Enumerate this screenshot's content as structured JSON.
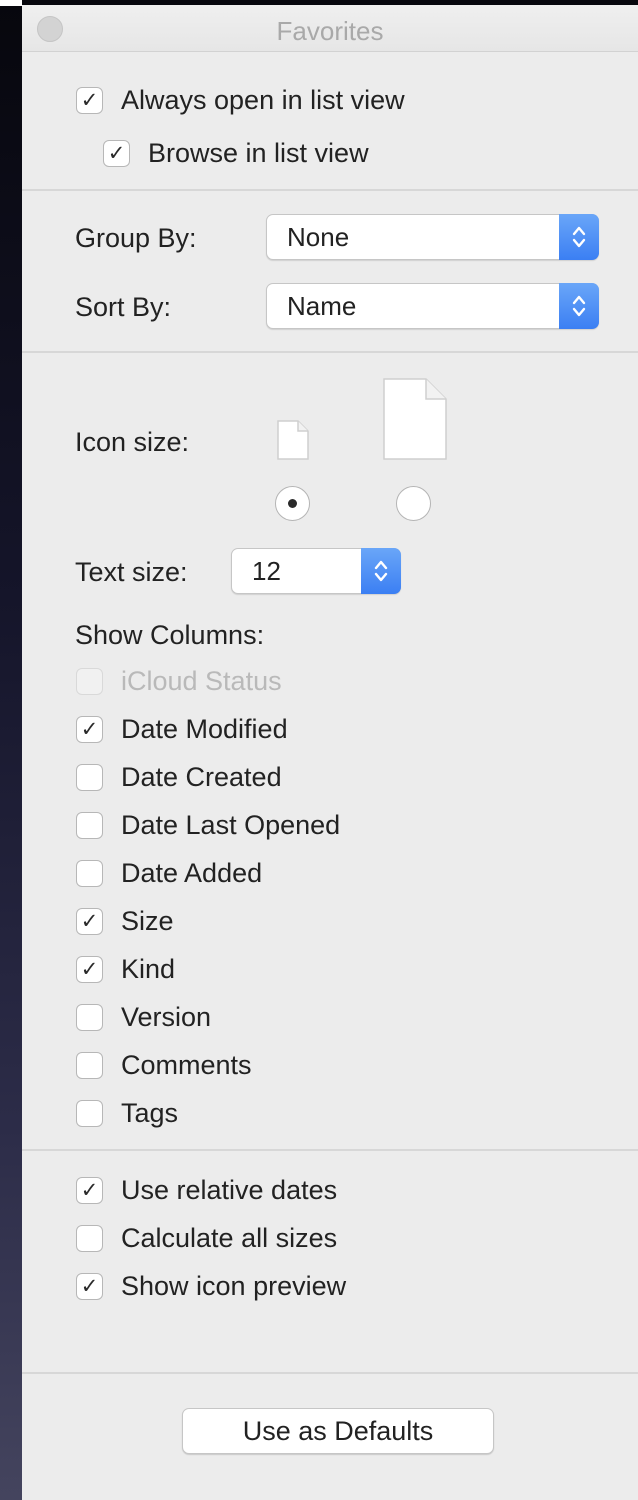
{
  "window": {
    "title": "Favorites"
  },
  "view_options": {
    "always_open_list": {
      "label": "Always open in list view",
      "checked": true
    },
    "browse_list": {
      "label": "Browse in list view",
      "checked": true
    }
  },
  "group_by": {
    "label": "Group By:",
    "value": "None"
  },
  "sort_by": {
    "label": "Sort By:",
    "value": "Name"
  },
  "icon_size": {
    "label": "Icon size:",
    "selected": "small"
  },
  "text_size": {
    "label": "Text size:",
    "value": "12"
  },
  "columns": {
    "heading": "Show Columns:",
    "items": [
      {
        "label": "iCloud Status",
        "checked": false,
        "disabled": true
      },
      {
        "label": "Date Modified",
        "checked": true,
        "disabled": false
      },
      {
        "label": "Date Created",
        "checked": false,
        "disabled": false
      },
      {
        "label": "Date Last Opened",
        "checked": false,
        "disabled": false
      },
      {
        "label": "Date Added",
        "checked": false,
        "disabled": false
      },
      {
        "label": "Size",
        "checked": true,
        "disabled": false
      },
      {
        "label": "Kind",
        "checked": true,
        "disabled": false
      },
      {
        "label": "Version",
        "checked": false,
        "disabled": false
      },
      {
        "label": "Comments",
        "checked": false,
        "disabled": false
      },
      {
        "label": "Tags",
        "checked": false,
        "disabled": false
      }
    ]
  },
  "options": {
    "items": [
      {
        "label": "Use relative dates",
        "checked": true
      },
      {
        "label": "Calculate all sizes",
        "checked": false
      },
      {
        "label": "Show icon preview",
        "checked": true
      }
    ]
  },
  "defaults_button": {
    "label": "Use as Defaults"
  },
  "icons": {
    "check": "✓",
    "stepper": "chevron-up-down-icon",
    "document": "document-icon"
  },
  "colors": {
    "accent": "#3b7ff3",
    "panel": "#ececec",
    "disabled_text": "#b9b9b9"
  }
}
